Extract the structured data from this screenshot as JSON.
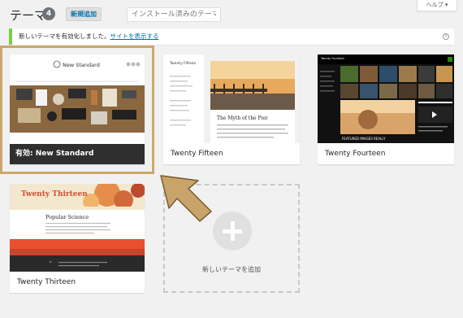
{
  "header": {
    "title": "テーマ",
    "count": "4",
    "add_new_label": "新規追加",
    "search_placeholder": "インストール済みのテーマを検索...",
    "help_label": "ヘルプ ▾"
  },
  "notice": {
    "text": "新しいテーマを有効化しました。",
    "link": "サイトを表示する",
    "close_icon": "dismiss-icon"
  },
  "themes": [
    {
      "name": "New Standard",
      "active_label": "有効:",
      "logo_text": "New Standard"
    },
    {
      "name": "Twenty Fifteen",
      "post_title": "The Myth of the Pier",
      "header_title": "Twenty Fifteen"
    },
    {
      "name": "Twenty Fourteen",
      "banner": "FEATURED IMAGES REALLY"
    },
    {
      "name": "Twenty Thirteen",
      "post_title": "Popular Science",
      "header_title": "Twenty Thirteen"
    }
  ],
  "add_new_theme_label": "新しいテーマを追加",
  "colors": {
    "active_border": "#caa96a",
    "notice_border": "#7ad03a",
    "link": "#0073aa",
    "active_bar": "#2f2f2f"
  }
}
